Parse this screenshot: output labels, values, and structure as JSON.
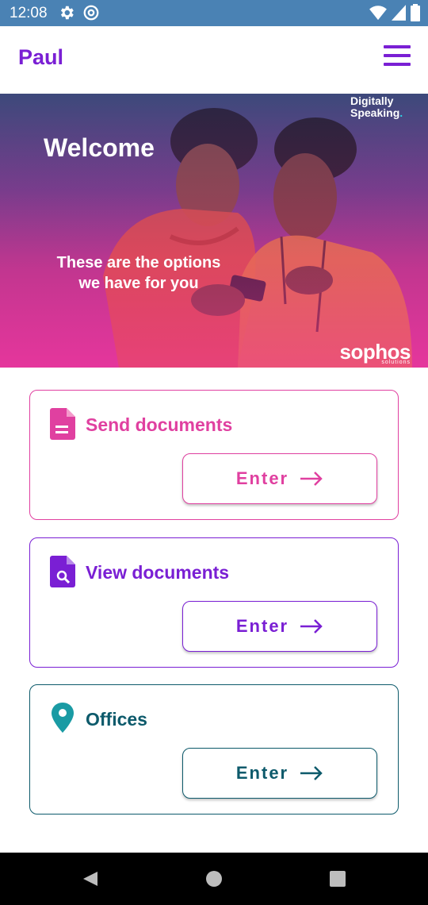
{
  "status_bar": {
    "time": "12:08",
    "icons": [
      "gear-icon",
      "at-sign-icon",
      "wifi-icon",
      "signal-icon",
      "battery-icon"
    ]
  },
  "header": {
    "user_name": "Paul",
    "menu_icon": "hamburger-menu-icon"
  },
  "hero": {
    "welcome": "Welcome",
    "options_line1": "These are the options",
    "options_line2": "we have for you",
    "brand_top_line1": "Digitally",
    "brand_top_line2": "Speaking",
    "brand_bottom": "sophos",
    "brand_bottom_sub": "solutions"
  },
  "cards": [
    {
      "title": "Send documents",
      "button": "Enter",
      "icon": "document-icon",
      "color": "#e040a0"
    },
    {
      "title": "View documents",
      "button": "Enter",
      "icon": "document-search-icon",
      "color": "#7a1fd4"
    },
    {
      "title": "Offices",
      "button": "Enter",
      "icon": "location-pin-icon",
      "color": "#0d5a6b"
    }
  ],
  "nav_bar": {
    "icons": [
      "back-icon",
      "home-icon",
      "recents-icon"
    ]
  },
  "colors": {
    "status_bar": "#4a82b4",
    "accent_purple": "#7a1fd4",
    "accent_pink": "#e040a0",
    "accent_teal": "#0d5a6b"
  }
}
